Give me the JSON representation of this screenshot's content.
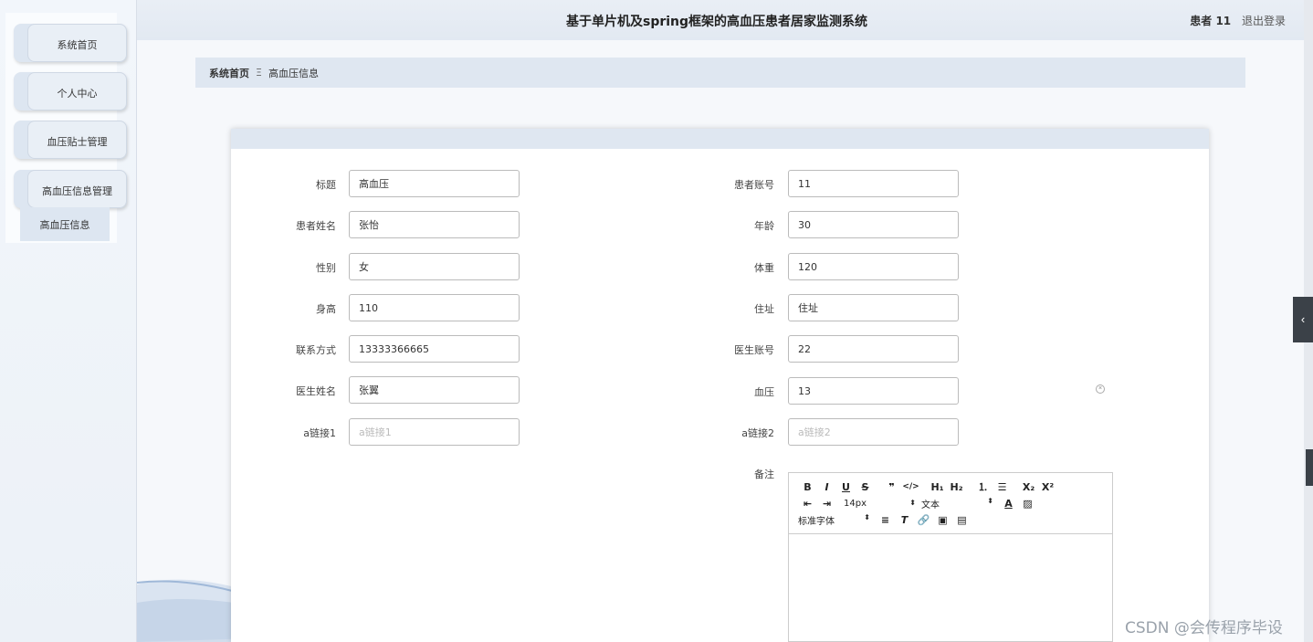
{
  "header": {
    "title": "基于单片机及spring框架的高血压患者居家监测系统",
    "user_label": "患者 11",
    "logout_label": "退出登录"
  },
  "sidebar": {
    "items": [
      {
        "label": "系统首页"
      },
      {
        "label": "个人中心"
      },
      {
        "label": "血压贴士管理"
      },
      {
        "label": "高血压信息管理"
      }
    ],
    "submenu": {
      "label": "高血压信息"
    }
  },
  "breadcrumb": {
    "home": "系统首页",
    "separator": "Ξ",
    "current": "高血压信息"
  },
  "form": {
    "left": [
      {
        "label": "标题",
        "value": "高血压",
        "placeholder": ""
      },
      {
        "label": "患者姓名",
        "value": "张怡",
        "placeholder": ""
      },
      {
        "label": "性别",
        "value": "女",
        "placeholder": ""
      },
      {
        "label": "身高",
        "value": "110",
        "placeholder": ""
      },
      {
        "label": "联系方式",
        "value": "13333366665",
        "placeholder": ""
      },
      {
        "label": "医生姓名",
        "value": "张翼",
        "placeholder": ""
      },
      {
        "label": "a链接1",
        "value": "",
        "placeholder": "a链接1"
      }
    ],
    "right": [
      {
        "label": "患者账号",
        "value": "11",
        "placeholder": ""
      },
      {
        "label": "年龄",
        "value": "30",
        "placeholder": ""
      },
      {
        "label": "体重",
        "value": "120",
        "placeholder": ""
      },
      {
        "label": "住址",
        "value": "住址",
        "placeholder": ""
      },
      {
        "label": "医生账号",
        "value": "22",
        "placeholder": ""
      },
      {
        "label": "血压",
        "value": "13",
        "placeholder": ""
      },
      {
        "label": "a链接2",
        "value": "",
        "placeholder": "a链接2"
      }
    ],
    "remark_label": "备注"
  },
  "editor": {
    "row1": [
      "B",
      "I",
      "U",
      "S",
      "❞",
      "</>",
      "H₁",
      "H₂",
      "⒈",
      "☰",
      "X₂",
      "X²"
    ],
    "font_size": "14px",
    "text_type": "文本",
    "font_family": "标准字体"
  },
  "watermark": "CSDN @会传程序毕设"
}
